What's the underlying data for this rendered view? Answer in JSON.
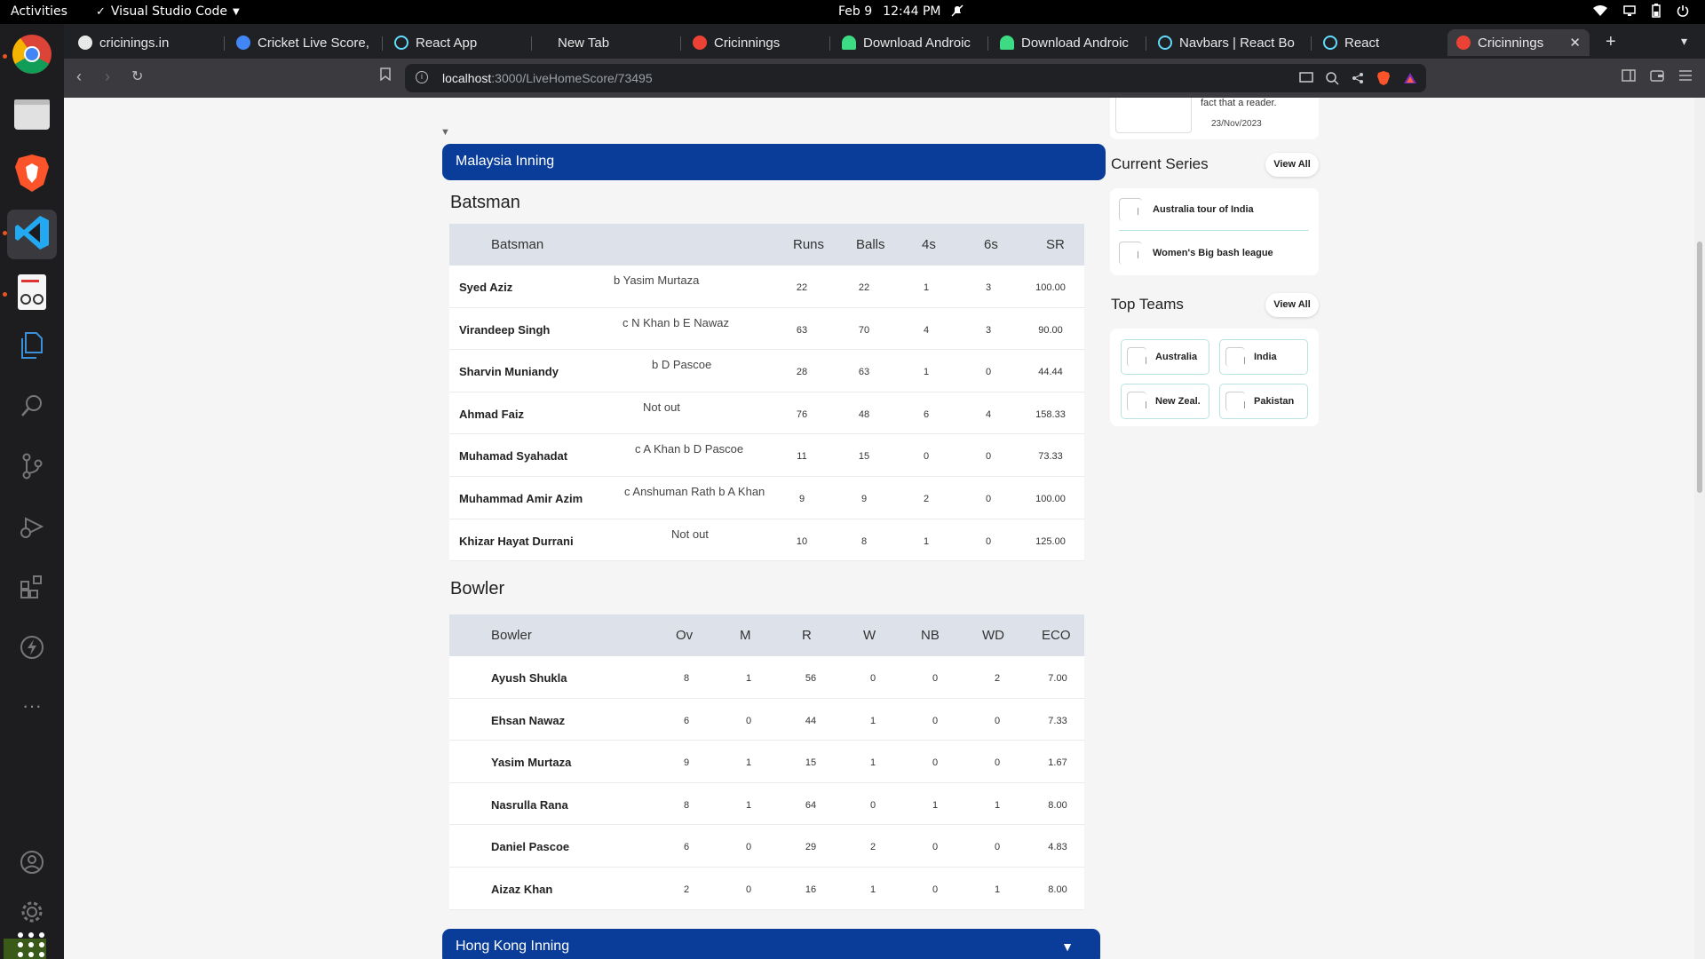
{
  "topbar": {
    "activities": "Activities",
    "app_name": "Visual Studio Code",
    "date": "Feb 9",
    "time": "12:44 PM"
  },
  "browser": {
    "tabs": [
      {
        "label": "cricinings.in",
        "color": "#e8e8e8"
      },
      {
        "label": "Cricket Live Score,",
        "color": "#4285f4"
      },
      {
        "label": "React App",
        "color": "#61dafb"
      },
      {
        "label": "New Tab",
        "color": ""
      },
      {
        "label": "Cricinnings",
        "color": "#ea4335"
      },
      {
        "label": "Download Androic",
        "color": "#3ddc84"
      },
      {
        "label": "Download Androic",
        "color": "#3ddc84"
      },
      {
        "label": "Navbars | React Bo",
        "color": "#61dafb"
      },
      {
        "label": "React",
        "color": "#61dafb"
      },
      {
        "label": "Cricinnings",
        "color": "#ea4335"
      }
    ],
    "url_host": "localhost",
    "url_path": ":3000/LiveHomeScore/73495"
  },
  "innings": [
    {
      "title": "Malaysia Inning"
    },
    {
      "title": "Hong Kong Inning"
    }
  ],
  "batting": {
    "section_title": "Batsman",
    "headers": {
      "batsman": "Batsman",
      "runs": "Runs",
      "balls": "Balls",
      "fours": "4s",
      "sixes": "6s",
      "sr": "SR"
    },
    "rows": [
      {
        "name": "Syed Aziz",
        "dismissal": "b Yasim Murtaza",
        "runs": "22",
        "balls": "22",
        "fours": "1",
        "sixes": "3",
        "sr": "100.00"
      },
      {
        "name": "Virandeep Singh",
        "dismissal": "c N Khan b E Nawaz",
        "runs": "63",
        "balls": "70",
        "fours": "4",
        "sixes": "3",
        "sr": "90.00"
      },
      {
        "name": "Sharvin Muniandy",
        "dismissal": "b D Pascoe",
        "runs": "28",
        "balls": "63",
        "fours": "1",
        "sixes": "0",
        "sr": "44.44"
      },
      {
        "name": "Ahmad Faiz",
        "dismissal": "Not out",
        "runs": "76",
        "balls": "48",
        "fours": "6",
        "sixes": "4",
        "sr": "158.33"
      },
      {
        "name": "Muhamad Syahadat",
        "dismissal": "c A Khan b D Pascoe",
        "runs": "11",
        "balls": "15",
        "fours": "0",
        "sixes": "0",
        "sr": "73.33"
      },
      {
        "name": "Muhammad Amir Azim",
        "dismissal": "c Anshuman Rath b A Khan",
        "runs": "9",
        "balls": "9",
        "fours": "2",
        "sixes": "0",
        "sr": "100.00"
      },
      {
        "name": "Khizar Hayat Durrani",
        "dismissal": "Not out",
        "runs": "10",
        "balls": "8",
        "fours": "1",
        "sixes": "0",
        "sr": "125.00"
      }
    ]
  },
  "bowling": {
    "section_title": "Bowler",
    "headers": {
      "bowler": "Bowler",
      "ov": "Ov",
      "m": "M",
      "r": "R",
      "w": "W",
      "nb": "NB",
      "wd": "WD",
      "eco": "ECO"
    },
    "rows": [
      {
        "name": "Ayush Shukla",
        "ov": "8",
        "m": "1",
        "r": "56",
        "w": "0",
        "nb": "0",
        "wd": "2",
        "eco": "7.00"
      },
      {
        "name": "Ehsan Nawaz",
        "ov": "6",
        "m": "0",
        "r": "44",
        "w": "1",
        "nb": "0",
        "wd": "0",
        "eco": "7.33"
      },
      {
        "name": "Yasim Murtaza",
        "ov": "9",
        "m": "1",
        "r": "15",
        "w": "1",
        "nb": "0",
        "wd": "0",
        "eco": "1.67"
      },
      {
        "name": "Nasrulla Rana",
        "ov": "8",
        "m": "1",
        "r": "64",
        "w": "0",
        "nb": "1",
        "wd": "1",
        "eco": "8.00"
      },
      {
        "name": "Daniel Pascoe",
        "ov": "6",
        "m": "0",
        "r": "29",
        "w": "2",
        "nb": "0",
        "wd": "0",
        "eco": "4.83"
      },
      {
        "name": "Aizaz Khan",
        "ov": "2",
        "m": "0",
        "r": "16",
        "w": "1",
        "nb": "0",
        "wd": "1",
        "eco": "8.00"
      }
    ]
  },
  "sidebar": {
    "news": {
      "snippet": "fact that a reader.",
      "date": "23/Nov/2023"
    },
    "current_series": {
      "title": "Current Series",
      "view_all": "View All",
      "items": [
        "Australia tour of India",
        "Women's Big bash league"
      ]
    },
    "top_teams": {
      "title": "Top Teams",
      "view_all": "View All",
      "teams": [
        "Australia",
        "India",
        "New Zeal.",
        "Pakistan"
      ]
    }
  },
  "colors": {
    "inning_header": "#0a3d99",
    "table_header": "#dde2ea",
    "team_border": "#b9e3dd"
  }
}
